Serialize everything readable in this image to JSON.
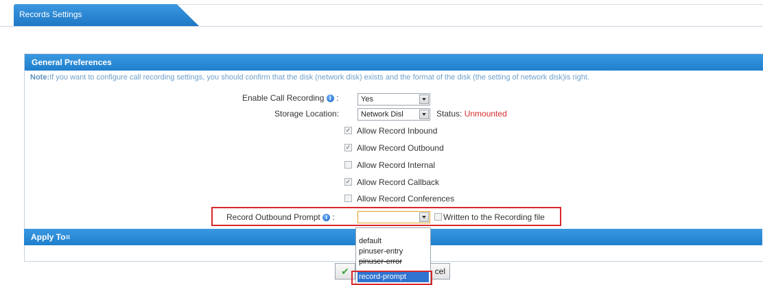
{
  "header": {
    "title": "Records Settings"
  },
  "general": {
    "title": "General Preferences",
    "note_label": "Note:",
    "note_text": "If you want to configure call recording settings, you should confirm that the disk (network disk) exists and the format of the disk (the setting of network disk)is right.",
    "enable_label": "Enable Call Recording",
    "colon": ":",
    "enable_value": "Yes",
    "storage_label": "Storage Location:",
    "storage_value": "Network Disl",
    "status_label": "Status:",
    "status_value": "Unmounted",
    "status_color": "#d62a2a",
    "checkboxes": [
      {
        "label": "Allow Record Inbound",
        "checked": true
      },
      {
        "label": "Allow Record Outbound",
        "checked": true
      },
      {
        "label": "Allow Record Internal",
        "checked": false
      },
      {
        "label": "Allow Record Callback",
        "checked": true
      },
      {
        "label": "Allow Record Conferences",
        "checked": false
      }
    ],
    "prompt_label": "Record Outbound Prompt",
    "prompt_value": "",
    "written_label": "Written to the Recording file",
    "written_checked": false
  },
  "apply": {
    "title": "Apply To",
    "icon": "chevron-down-icon"
  },
  "buttons": {
    "save_icon": "check-icon",
    "cancel_label": "cel"
  },
  "dropdown": {
    "options": [
      "default",
      "pinuser-entry",
      "pinuser-error",
      "record-prompt"
    ],
    "selected": "record-prompt"
  },
  "colors": {
    "header_blue": "#1f7fcd",
    "highlight_red": "#d8262a",
    "selected_blue": "#2f73d0"
  }
}
